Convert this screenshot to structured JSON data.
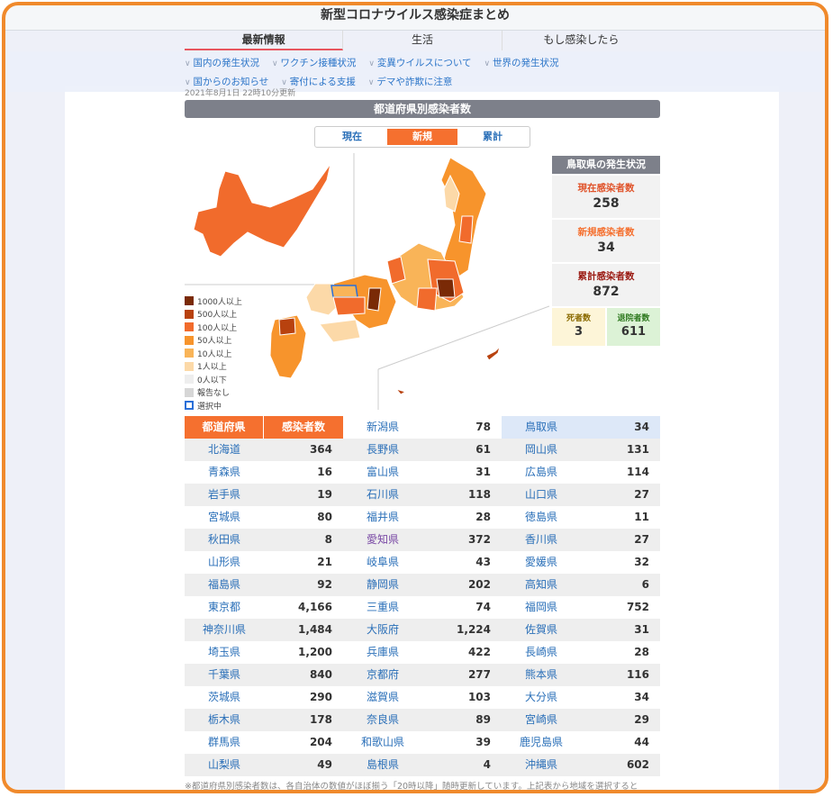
{
  "title": "新型コロナウイルス感染症まとめ",
  "tabs": [
    "最新情報",
    "生活",
    "もし感染したら"
  ],
  "subnav": {
    "row1": [
      "国内の発生状況",
      "ワクチン接種状況",
      "変異ウイルスについて",
      "世界の発生状況"
    ],
    "row2": [
      "国からのお知らせ",
      "寄付による支援",
      "デマや詐欺に注意"
    ]
  },
  "date_partial": "2021年8月1日 22時10分更新",
  "section_header": "都道府県別感染者数",
  "segment": {
    "options": [
      "現在",
      "新規",
      "累計"
    ],
    "selected": "新規"
  },
  "legend": [
    {
      "label": "1000人以上",
      "color": "#7a2a06"
    },
    {
      "label": "500人以上",
      "color": "#b8420f"
    },
    {
      "label": "100人以上",
      "color": "#f16b2c"
    },
    {
      "label": "50人以上",
      "color": "#f7942c"
    },
    {
      "label": "10人以上",
      "color": "#f9b458"
    },
    {
      "label": "1人以上",
      "color": "#fcd9a8"
    },
    {
      "label": "0人以下",
      "color": "#eeeeee"
    },
    {
      "label": "報告なし",
      "color": "#d6d6d6"
    },
    {
      "label": "選択中",
      "color": "#ffffff"
    }
  ],
  "panel": {
    "title": "鳥取県の発生状況",
    "current_label": "現在感染者数",
    "current_value": "258",
    "new_label": "新規感染者数",
    "new_value": "34",
    "total_label": "累計感染者数",
    "total_value": "872",
    "deaths_label": "死者数",
    "deaths_value": "3",
    "recovered_label": "退院者数",
    "recovered_value": "611",
    "colors": {
      "current": "#e0542b",
      "new": "#f5702f",
      "total": "#9a1a12"
    }
  },
  "table": {
    "headers": [
      "都道府県",
      "感染者数"
    ],
    "col1": [
      [
        "北海道",
        "364"
      ],
      [
        "青森県",
        "16"
      ],
      [
        "岩手県",
        "19"
      ],
      [
        "宮城県",
        "80"
      ],
      [
        "秋田県",
        "8"
      ],
      [
        "山形県",
        "21"
      ],
      [
        "福島県",
        "92"
      ],
      [
        "東京都",
        "4,166"
      ],
      [
        "神奈川県",
        "1,484"
      ],
      [
        "埼玉県",
        "1,200"
      ],
      [
        "千葉県",
        "840"
      ],
      [
        "茨城県",
        "290"
      ],
      [
        "栃木県",
        "178"
      ],
      [
        "群馬県",
        "204"
      ],
      [
        "山梨県",
        "49"
      ]
    ],
    "col2": [
      [
        "新潟県",
        "78"
      ],
      [
        "長野県",
        "61"
      ],
      [
        "富山県",
        "31"
      ],
      [
        "石川県",
        "118"
      ],
      [
        "福井県",
        "28"
      ],
      [
        "愛知県",
        "372"
      ],
      [
        "岐阜県",
        "43"
      ],
      [
        "静岡県",
        "202"
      ],
      [
        "三重県",
        "74"
      ],
      [
        "大阪府",
        "1,224"
      ],
      [
        "兵庫県",
        "422"
      ],
      [
        "京都府",
        "277"
      ],
      [
        "滋賀県",
        "103"
      ],
      [
        "奈良県",
        "89"
      ],
      [
        "和歌山県",
        "39"
      ],
      [
        "島根県",
        "4"
      ]
    ],
    "col3": [
      [
        "鳥取県",
        "34"
      ],
      [
        "岡山県",
        "131"
      ],
      [
        "広島県",
        "114"
      ],
      [
        "山口県",
        "27"
      ],
      [
        "徳島県",
        "11"
      ],
      [
        "香川県",
        "27"
      ],
      [
        "愛媛県",
        "32"
      ],
      [
        "高知県",
        "6"
      ],
      [
        "福岡県",
        "752"
      ],
      [
        "佐賀県",
        "31"
      ],
      [
        "長崎県",
        "28"
      ],
      [
        "熊本県",
        "116"
      ],
      [
        "大分県",
        "34"
      ],
      [
        "宮崎県",
        "29"
      ],
      [
        "鹿児島県",
        "44"
      ],
      [
        "沖縄県",
        "602"
      ]
    ]
  },
  "footnote": "※都道府県別感染者数は、各自治体の数値がほぼ揃う「20時以降」随時更新しています。上記表から地域を選択すると"
}
